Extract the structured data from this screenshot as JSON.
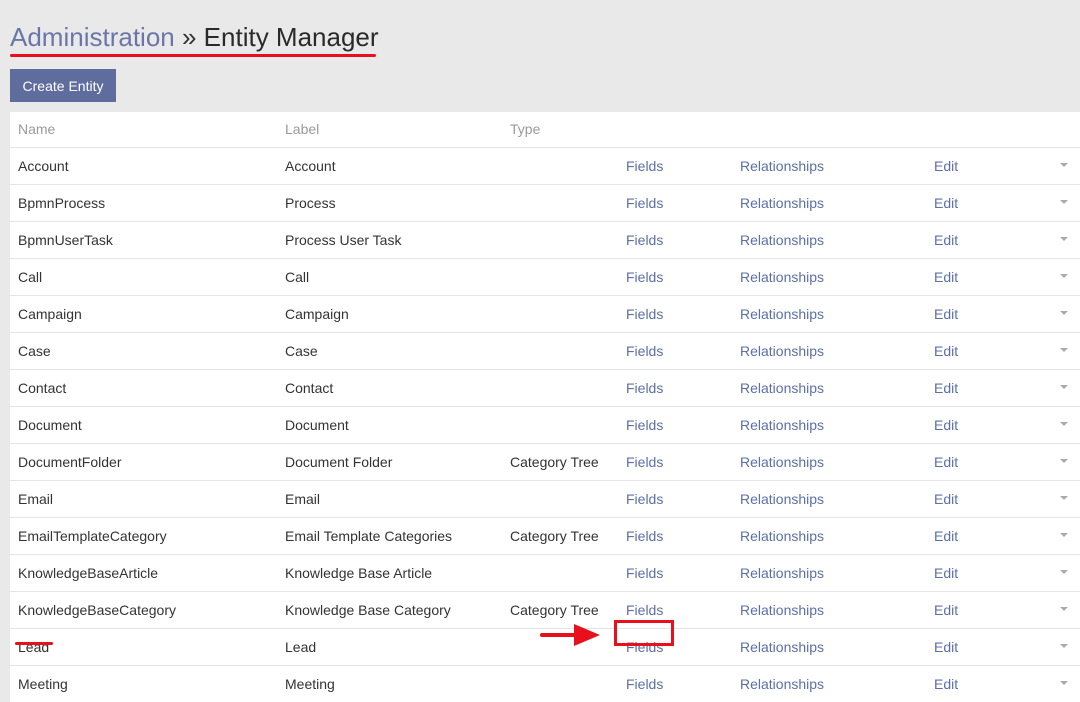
{
  "breadcrumb": {
    "parent": "Administration",
    "separator": "»",
    "current": "Entity Manager"
  },
  "create_button": "Create Entity",
  "table": {
    "columns": [
      "Name",
      "Label",
      "Type"
    ],
    "rows": [
      {
        "name": "Account",
        "label": "Account",
        "type": "",
        "fields": "Fields",
        "relationships": "Relationships",
        "edit": "Edit"
      },
      {
        "name": "BpmnProcess",
        "label": "Process",
        "type": "",
        "fields": "Fields",
        "relationships": "Relationships",
        "edit": "Edit"
      },
      {
        "name": "BpmnUserTask",
        "label": "Process User Task",
        "type": "",
        "fields": "Fields",
        "relationships": "Relationships",
        "edit": "Edit"
      },
      {
        "name": "Call",
        "label": "Call",
        "type": "",
        "fields": "Fields",
        "relationships": "Relationships",
        "edit": "Edit"
      },
      {
        "name": "Campaign",
        "label": "Campaign",
        "type": "",
        "fields": "Fields",
        "relationships": "Relationships",
        "edit": "Edit"
      },
      {
        "name": "Case",
        "label": "Case",
        "type": "",
        "fields": "Fields",
        "relationships": "Relationships",
        "edit": "Edit"
      },
      {
        "name": "Contact",
        "label": "Contact",
        "type": "",
        "fields": "Fields",
        "relationships": "Relationships",
        "edit": "Edit"
      },
      {
        "name": "Document",
        "label": "Document",
        "type": "",
        "fields": "Fields",
        "relationships": "Relationships",
        "edit": "Edit"
      },
      {
        "name": "DocumentFolder",
        "label": "Document Folder",
        "type": "Category Tree",
        "fields": "Fields",
        "relationships": "Relationships",
        "edit": "Edit"
      },
      {
        "name": "Email",
        "label": "Email",
        "type": "",
        "fields": "Fields",
        "relationships": "Relationships",
        "edit": "Edit"
      },
      {
        "name": "EmailTemplateCategory",
        "label": "Email Template Categories",
        "type": "Category Tree",
        "fields": "Fields",
        "relationships": "Relationships",
        "edit": "Edit"
      },
      {
        "name": "KnowledgeBaseArticle",
        "label": "Knowledge Base Article",
        "type": "",
        "fields": "Fields",
        "relationships": "Relationships",
        "edit": "Edit"
      },
      {
        "name": "KnowledgeBaseCategory",
        "label": "Knowledge Base Category",
        "type": "Category Tree",
        "fields": "Fields",
        "relationships": "Relationships",
        "edit": "Edit"
      },
      {
        "name": "Lead",
        "label": "Lead",
        "type": "",
        "fields": "Fields",
        "relationships": "Relationships",
        "edit": "Edit"
      },
      {
        "name": "Meeting",
        "label": "Meeting",
        "type": "",
        "fields": "Fields",
        "relationships": "Relationships",
        "edit": "Edit"
      }
    ]
  },
  "colors": {
    "accent": "#5f6d9e",
    "link": "#5c6fa7",
    "annotation": "#e8101a"
  }
}
